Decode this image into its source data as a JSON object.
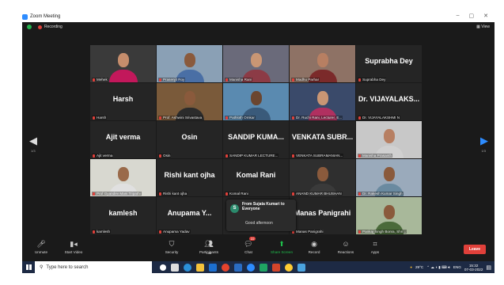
{
  "window": {
    "title": "Zoom Meeting",
    "minimize": "–",
    "maximize": "▢",
    "close": "✕"
  },
  "topbar": {
    "recording": "Recording",
    "view": "View"
  },
  "pages": {
    "left": "1/3",
    "right": "1/3"
  },
  "tiles": [
    {
      "type": "video",
      "label": "Mehek",
      "skin": "#c58d6c",
      "shirt": "#c2185b",
      "bg": "#3a3a3a"
    },
    {
      "type": "video",
      "label": "Prasenjit Roy",
      "skin": "#8a5a3c",
      "shirt": "#4a6fa5",
      "bg": "#8aa0b5"
    },
    {
      "type": "video",
      "label": "Manisha Rani",
      "skin": "#c99674",
      "shirt": "#8c3b46",
      "bg": "#6a6a7a"
    },
    {
      "type": "video",
      "label": "Madhu Parhar",
      "skin": "#b77f62",
      "shirt": "#7b2a2a",
      "bg": "#8e7265"
    },
    {
      "type": "name",
      "big": "Suprabha Dey",
      "label": "Suprabha Dey"
    },
    {
      "type": "name",
      "big": "Harsh",
      "label": "Harsh"
    },
    {
      "type": "video",
      "label": "Prof. Ashwini Srivastava",
      "skin": "#8a5a3c",
      "shirt": "#2b2b2b",
      "bg": "#7a5a3a"
    },
    {
      "type": "video",
      "label": "Pathloth Omkar",
      "skin": "#6b4630",
      "shirt": "#3a5a7a",
      "bg": "#5a8ab0"
    },
    {
      "type": "video",
      "label": "Dr. Ruchi Rani, Lecturer, E...",
      "skin": "#c99674",
      "shirt": "#b03060",
      "bg": "#3a4a6a"
    },
    {
      "type": "name",
      "big": "Dr. VIJAYALAKS...",
      "label": "Dr. VIJAYALAKSHMI N"
    },
    {
      "type": "name",
      "big": "Ajit verma",
      "label": "Ajit verma"
    },
    {
      "type": "name",
      "big": "Osin",
      "label": "Osin"
    },
    {
      "type": "name",
      "big": "SANDIP KUMA...",
      "label": "SANDIP KUMAR LECTURE..."
    },
    {
      "type": "name",
      "big": "VENKATA SUBR...",
      "label": "VENKATA SUBRAMANIAN..."
    },
    {
      "type": "video",
      "label": "Manisha Prasanth",
      "skin": "#b77f62",
      "shirt": "#d0d0d0",
      "bg": "#c8c8c8"
    },
    {
      "type": "video",
      "label": "Prof Gyandev Mani Tripathi",
      "skin": "#9a6a4a",
      "shirt": "#e0e0e0",
      "bg": "#d8d8d0",
      "active": true
    },
    {
      "type": "name",
      "big": "Rishi kant ojha",
      "label": "Rishi kant ojha"
    },
    {
      "type": "name",
      "big": "Komal Rani",
      "label": "Komal Rani"
    },
    {
      "type": "video",
      "label": "ANAND KUMAR BHUSHAN",
      "skin": "#8a5a3c",
      "shirt": "#3a3a3a",
      "bg": "#2f2f2f"
    },
    {
      "type": "video",
      "label": "Dr. Rakesh Kumar Singh",
      "skin": "#8a5a3c",
      "shirt": "#6a8aa0",
      "bg": "#9aaabb"
    },
    {
      "type": "name",
      "big": "kamlesh",
      "label": "kamlesh"
    },
    {
      "type": "name",
      "big": "Anupama Y...",
      "label": "Anupama Yadav"
    },
    {
      "type": "blank",
      "label": ""
    },
    {
      "type": "name",
      "big": "Manas Panigrahi",
      "label": "Manas Panigrahi"
    },
    {
      "type": "video",
      "label": "Pankaj Singh Bonra, Shri...",
      "skin": "#8a5a3c",
      "shirt": "#4a6a3a",
      "bg": "#a8b89a"
    }
  ],
  "chat_popup": {
    "avatar": "S",
    "from": "From Sujata Kumari to Everyone",
    "message": "Good afternoon"
  },
  "toolbar": {
    "unmute": "Unmute",
    "start_video": "Start Video",
    "security": "Security",
    "participants": "Participants",
    "participants_count": "186",
    "chat": "Chat",
    "chat_badge": "22",
    "share_screen": "Share Screen",
    "record": "Record",
    "reactions": "Reactions",
    "apps": "Apps",
    "leave": "Leave"
  },
  "taskbar": {
    "search_placeholder": "Type here to search",
    "weather": "29°C",
    "lang": "ENG",
    "time": "15:32",
    "date": "07-03-2022"
  }
}
